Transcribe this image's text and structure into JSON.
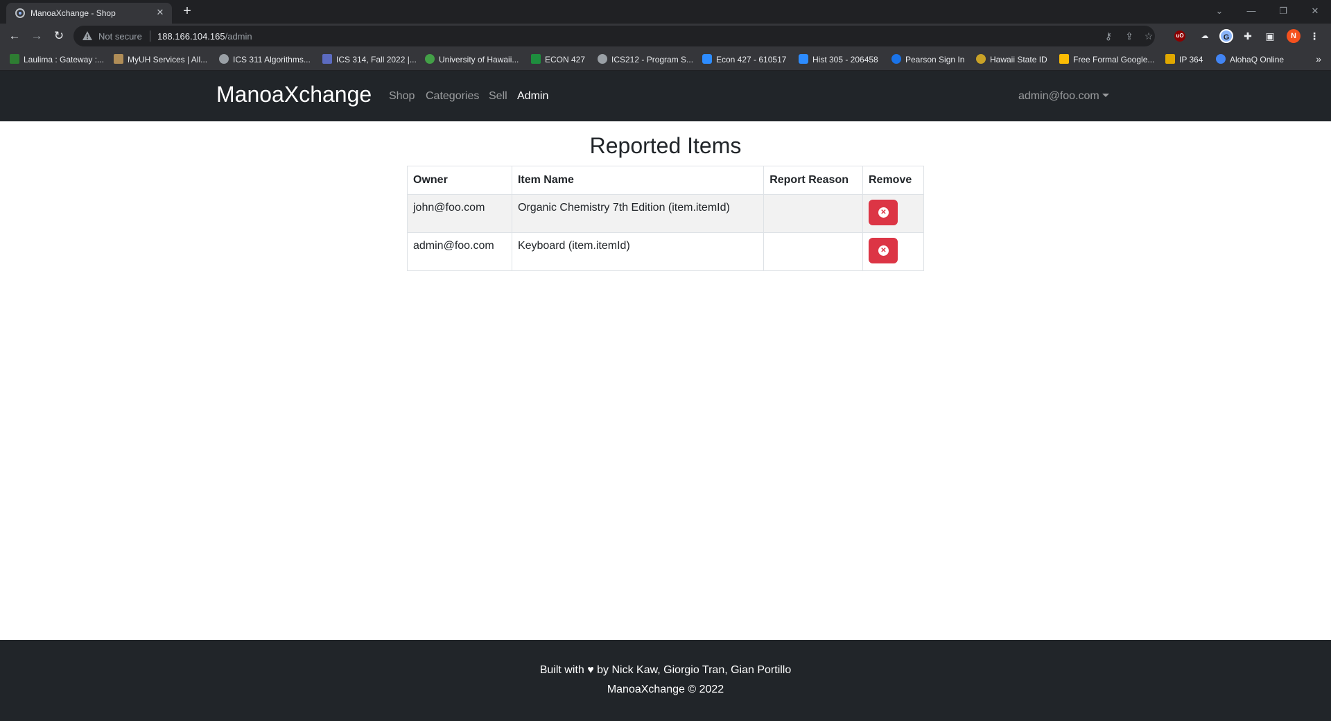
{
  "browser": {
    "tab_title": "ManoaXchange - Shop",
    "new_tab_symbol": "+",
    "security_label": "Not secure",
    "url_host": "188.166.104.165",
    "url_path": "/admin",
    "profile_initial": "N",
    "bookmarks": [
      {
        "label": "Laulima : Gateway :...",
        "icon_color": "#2e7d32"
      },
      {
        "label": "MyUH Services | All...",
        "icon_color": "#b08d57"
      },
      {
        "label": "ICS 311 Algorithms...",
        "icon_color": "#9aa0a6"
      },
      {
        "label": "ICS 314, Fall 2022 |...",
        "icon_color": "#5c6bc0"
      },
      {
        "label": "University of Hawaii...",
        "icon_color": "#43a047"
      },
      {
        "label": "ECON 427",
        "icon_color": "#1e8e3e"
      },
      {
        "label": "ICS212 - Program S...",
        "icon_color": "#9aa0a6"
      },
      {
        "label": "Econ 427 - 610517",
        "icon_color": "#2d8cff"
      },
      {
        "label": "Hist 305 - 206458",
        "icon_color": "#2d8cff"
      },
      {
        "label": "Pearson Sign In",
        "icon_color": "#1a73e8"
      },
      {
        "label": "Hawaii State ID",
        "icon_color": "#c9a227"
      },
      {
        "label": "Free Formal Google...",
        "icon_color": "#fbbc04"
      },
      {
        "label": "IP 364",
        "icon_color": "#e0a800"
      },
      {
        "label": "AlohaQ Online",
        "icon_color": "#4285f4"
      }
    ]
  },
  "navbar": {
    "brand": "ManoaXchange",
    "links": [
      "Shop",
      "Categories",
      "Sell",
      "Admin"
    ],
    "active_link": "Admin",
    "user": "admin@foo.com"
  },
  "main": {
    "title": "Reported Items",
    "table": {
      "headers": [
        "Owner",
        "Item Name",
        "Report Reason",
        "Remove"
      ],
      "rows": [
        {
          "owner": "john@foo.com",
          "item_name": "Organic Chemistry 7th Edition (item.itemId)",
          "report_reason": ""
        },
        {
          "owner": "admin@foo.com",
          "item_name": "Keyboard (item.itemId)",
          "report_reason": ""
        }
      ]
    }
  },
  "footer": {
    "line1": "Built with ♥ by Nick Kaw,  Giorgio Tran,  Gian Portillo",
    "line2": "ManoaXchange © 2022"
  },
  "colors": {
    "navbar_bg": "#212529",
    "danger": "#dc3545",
    "chrome_dark": "#202124",
    "chrome_toolbar": "#35363a"
  }
}
